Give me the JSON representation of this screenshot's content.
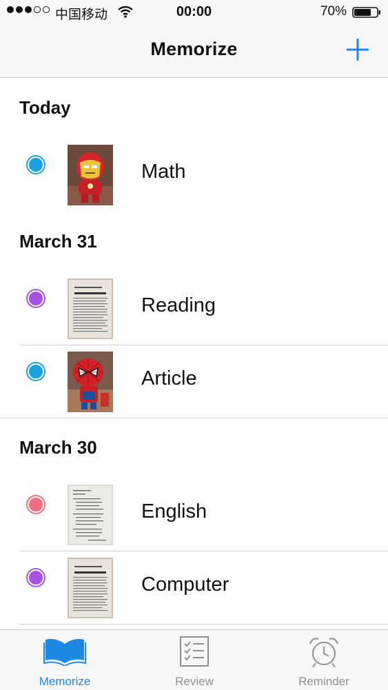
{
  "status_bar": {
    "carrier": "中国移动",
    "time": "00:00",
    "battery": "70%"
  },
  "nav": {
    "title": "Memorize",
    "add_icon": "plus-icon"
  },
  "sections": [
    {
      "header": "Today",
      "items": [
        {
          "label": "Math",
          "dot_color": "#1ba1e2",
          "thumb": "ironman-figure"
        }
      ]
    },
    {
      "header": "March 31",
      "items": [
        {
          "label": "Reading",
          "dot_color": "#a552e0",
          "thumb": "document-page"
        },
        {
          "label": "Article",
          "dot_color": "#1ba1e2",
          "thumb": "spiderman-figure"
        }
      ]
    },
    {
      "header": "March 30",
      "items": [
        {
          "label": "English",
          "dot_color": "#ee6f7c",
          "thumb": "document-page"
        },
        {
          "label": "Computer",
          "dot_color": "#a552e0",
          "thumb": "document-page"
        }
      ]
    }
  ],
  "tabs": [
    {
      "label": "Memorize",
      "icon": "open-book-icon",
      "active": true
    },
    {
      "label": "Review",
      "icon": "checklist-icon",
      "active": false
    },
    {
      "label": "Reminder",
      "icon": "alarm-clock-icon",
      "active": false
    }
  ],
  "colors": {
    "accent": "#1e88e5",
    "tab_inactive": "#8e8e93"
  }
}
